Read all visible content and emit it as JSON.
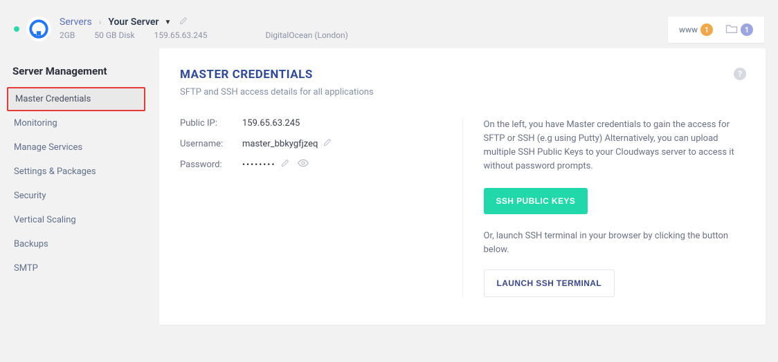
{
  "header": {
    "breadcrumb_link": "Servers",
    "breadcrumb_current": "Your Server",
    "meta_ram": "2GB",
    "meta_disk": "50 GB Disk",
    "meta_ip": "159.65.63.245",
    "meta_provider": "DigitalOcean (London)"
  },
  "badges": {
    "www_label": "www",
    "www_count": "1",
    "folder_count": "1"
  },
  "sidebar": {
    "title": "Server Management",
    "items": [
      "Master Credentials",
      "Monitoring",
      "Manage Services",
      "Settings & Packages",
      "Security",
      "Vertical Scaling",
      "Backups",
      "SMTP"
    ]
  },
  "content": {
    "title": "MASTER CREDENTIALS",
    "subtitle": "SFTP and SSH access details for all applications",
    "public_ip_label": "Public IP:",
    "public_ip_value": "159.65.63.245",
    "username_label": "Username:",
    "username_value": "master_bbkygfjzeq",
    "password_label": "Password:",
    "password_mask": "••••••••",
    "right_desc": "On the left, you have Master credentials to gain the access for SFTP or SSH (e.g using Putty) Alternatively, you can upload multiple SSH Public Keys to your Cloudways server to access it without password prompts.",
    "ssh_keys_btn": "SSH PUBLIC KEYS",
    "or_text": "Or, launch SSH terminal in your browser by clicking the button below.",
    "launch_btn": "LAUNCH SSH TERMINAL",
    "help_icon": "?"
  }
}
